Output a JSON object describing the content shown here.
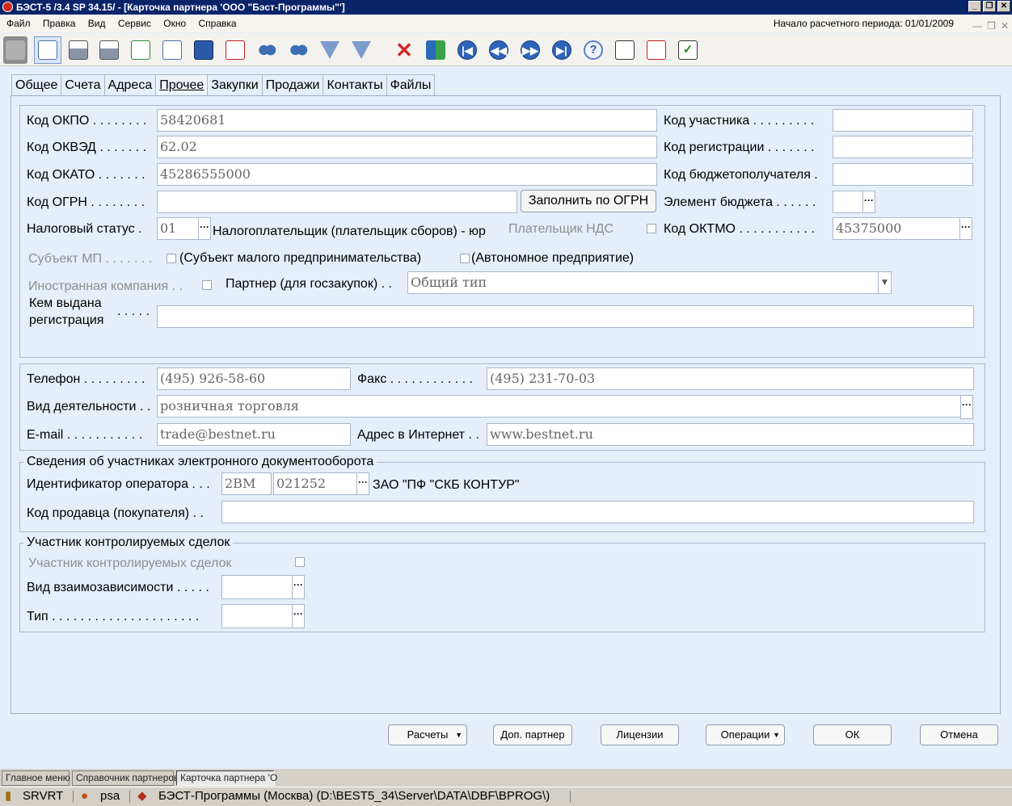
{
  "window": {
    "title": "БЭСТ-5 /3.4 SP 34.15/ - [Карточка партнера 'ООО \"Бэст-Программы\"']"
  },
  "menu": {
    "items": [
      "Файл",
      "Правка",
      "Вид",
      "Сервис",
      "Окно",
      "Справка"
    ],
    "period": "Начало расчетного периода: 01/01/2009"
  },
  "tabs": [
    "Общее",
    "Счета",
    "Адреса",
    "Прочее",
    "Закупки",
    "Продажи",
    "Контакты",
    "Файлы"
  ],
  "active_tab": "Прочее",
  "codes": {
    "okpo_label": "Код ОКПО . . . . . . . .",
    "okpo": "58420681",
    "okved_label": "Код ОКВЭД . . . . . . .",
    "okved": "62.02",
    "okato_label": "Код ОКАТО . . . . . . .",
    "okato": "45286555000",
    "ogrn_label": "Код ОГРН . . . . . . . .",
    "ogrn": "",
    "fill_ogrn_button": "Заполнить по ОГРН",
    "tax_status_label": "Налоговый статус  .",
    "tax_status": "01",
    "tax_status_desc": "Налогоплательщик (плательщик сборов) - юр",
    "vat_payer_label": "Плательщик НДС",
    "participant_label": "Код участника . . . . . . . . .",
    "participant": "",
    "registration_label": "Код регистрации . . . . . . .",
    "registration": "",
    "budget_recipient_label": "Код бюджетополучателя .",
    "budget_recipient": "",
    "budget_element_label": "Элемент бюджета . . . . . .",
    "budget_element": "",
    "oktmo_label": "Код ОКТМО . . . . . . . . . . .",
    "oktmo": "45375000",
    "smb_label": "Субъект МП . . . . . . .",
    "smb_check_label": "(Субъект малого предпринимательства)",
    "autonomous_check_label": "(Автономное предприятие)",
    "foreign_label": "Иностранная компания . .",
    "partner_gov_label": "Партнер (для госзакупок) . .",
    "partner_gov": "Общий тип",
    "issued_by_label_1": "Кем выдана",
    "issued_by_label_2": "регистрация",
    "issued_by_dots": ". . . . .",
    "issued_by": ""
  },
  "contacts": {
    "phone_label": "Телефон . . . . . . . . .",
    "phone": "(495) 926-58-60",
    "fax_label": "Факс . . . . . . . . . . . .",
    "fax": "(495) 231-70-03",
    "activity_label": "Вид деятельности . .",
    "activity": "розничная торговля",
    "email_label": "E-mail . . . . . . . . . . .",
    "email": "trade@bestnet.ru",
    "web_label": "Адрес в Интернет . .",
    "web": "www.bestnet.ru"
  },
  "edo": {
    "title": "Сведения об участниках электронного документооборота",
    "operator_label": "Идентификатор оператора . . .",
    "operator_prefix": "2BM",
    "operator_code": "021252",
    "operator_name": "ЗАО \"ПФ \"СКБ КОНТУР\"",
    "seller_code_label": "Код продавца (покупателя) . .",
    "seller_code": ""
  },
  "controlled": {
    "title": "Участник контролируемых сделок",
    "participant_label": "Участник контролируемых сделок",
    "interdependence_label": "Вид взаимозависимости . . . . .",
    "interdependence": "",
    "type_label": "Тип . . . . . . . . . . . . . . . . . . . . .",
    "type": ""
  },
  "buttons": {
    "calc": "Расчеты",
    "extra_partner": "Доп. партнер",
    "licenses": "Лицензии",
    "operations": "Операции",
    "ok": "ОК",
    "cancel": "Отмена"
  },
  "taskbar": [
    "Главное меню",
    "Справочник партнеров",
    "Карточка партнера 'О"
  ],
  "status": {
    "server": "SRVRT",
    "user": "psa",
    "db": "БЭСТ-Программы (Москва) (D:\\BEST5_34\\Server\\DATA\\DBF\\BPROG\\)"
  }
}
